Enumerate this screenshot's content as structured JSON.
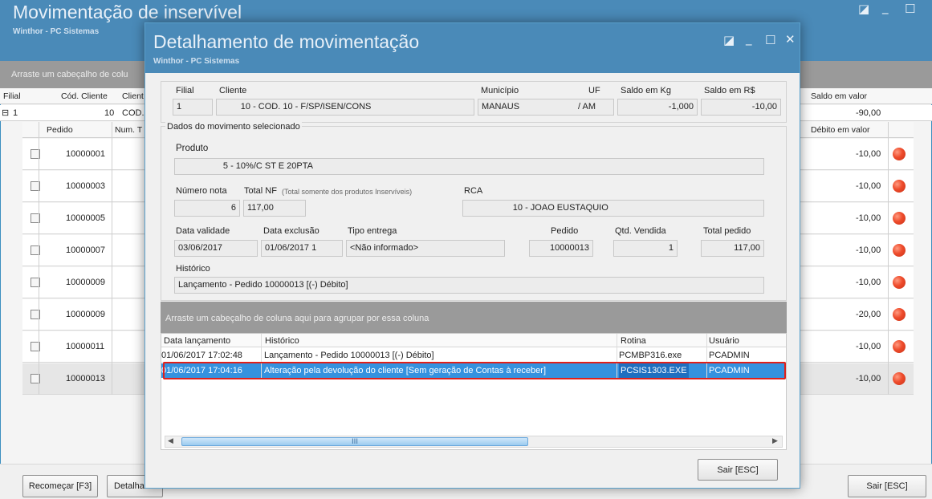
{
  "background_window": {
    "title": "Movimentação de inservível",
    "subtitle": "Winthor - PC Sistemas",
    "controls": {
      "restore": "◪",
      "minimize": "_",
      "maximize": "☐"
    },
    "group_hint": "Arraste um cabeçalho de colu",
    "headers": {
      "filial": "Filial",
      "cod_cliente": "Cód. Cliente",
      "cliente": "Client",
      "saldo_valor": "Saldo em valor"
    },
    "summary_row": {
      "expand": "⊟",
      "filial": "1",
      "cod_cliente": "10",
      "cliente": "COD.",
      "saldo_valor": "-90,00"
    },
    "detail_headers": {
      "pedido": "Pedido",
      "num": "Num. T",
      "debito": "Débito em valor"
    },
    "rows": [
      {
        "pedido": "10000001",
        "debito": "-10,00"
      },
      {
        "pedido": "10000003",
        "debito": "-10,00"
      },
      {
        "pedido": "10000005",
        "debito": "-10,00"
      },
      {
        "pedido": "10000007",
        "debito": "-10,00"
      },
      {
        "pedido": "10000009",
        "debito": "-10,00"
      },
      {
        "pedido": "10000009",
        "debito": "-20,00"
      },
      {
        "pedido": "10000011",
        "debito": "-10,00"
      },
      {
        "pedido": "10000013",
        "debito": "-10,00"
      }
    ],
    "buttons": {
      "recomecar": "Recomeçar [F3]",
      "detalhes": "Detalha",
      "sair": "Sair [ESC]"
    }
  },
  "dialog": {
    "title": "Detalhamento de movimentação",
    "subtitle": "Winthor - PC Sistemas",
    "controls": {
      "restore": "◪",
      "minimize": "_",
      "maximize": "☐",
      "close": "✕"
    },
    "header": {
      "labels": {
        "filial": "Filial",
        "cliente": "Cliente",
        "municipio": "Município",
        "uf": "UF",
        "saldo_kg": "Saldo em Kg",
        "saldo_rs": "Saldo em R$"
      },
      "values": {
        "filial": "1",
        "cliente_cod": "10",
        "cliente_nome": "COD. 10 - F/SP/ISEN/CONS",
        "municipio": "MANAUS",
        "uf": "AM",
        "saldo_kg": "-1,000",
        "saldo_rs": "-10,00"
      }
    },
    "movement": {
      "section_title": "Dados do movimento selecionado",
      "labels": {
        "produto": "Produto",
        "numero_nota": "Número nota",
        "total_nf": "Total NF",
        "total_nf_note": "(Total somente dos produtos Inservíveis)",
        "rca": "RCA",
        "data_validade": "Data validade",
        "data_exclusao": "Data exclusão",
        "tipo_entrega": "Tipo entrega",
        "pedido": "Pedido",
        "qtd_vendida": "Qtd. Vendida",
        "total_pedido": "Total pedido",
        "historico": "Histórico"
      },
      "values": {
        "produto_cod": "5",
        "produto_nome": "10%/C ST E 20PTA",
        "numero_nota": "6",
        "total_nf": "117,00",
        "rca_cod": "10",
        "rca_nome": "JOAO EUSTAQUIO",
        "data_validade": "03/06/2017",
        "data_exclusao": "01/06/2017 1",
        "tipo_entrega": "<Não informado>",
        "pedido": "10000013",
        "qtd_vendida": "1",
        "total_pedido": "117,00",
        "historico": "Lançamento - Pedido 10000013 [(-) Débito]"
      }
    },
    "history_grid": {
      "group_hint": "Arraste um cabeçalho de coluna aqui para agrupar por essa coluna",
      "headers": {
        "data": "Data lançamento",
        "historico": "Histórico",
        "rotina": "Rotina",
        "usuario": "Usuário"
      },
      "rows": [
        {
          "data": "01/06/2017 17:02:48",
          "historico": "Lançamento - Pedido 10000013 [(-) Débito]",
          "rotina": "PCMBP316.exe",
          "usuario": "PCADMIN"
        },
        {
          "data": "01/06/2017 17:04:16",
          "historico": "Alteração pela devolução do cliente [Sem geração de Contas à receber]",
          "rotina": "PCSIS1303.EXE",
          "usuario": "PCADMIN"
        }
      ],
      "scroll_thumb": "III"
    },
    "exit_button": "Sair [ESC]",
    "highlight_color": "#e0201a",
    "selection_color": "#2f8fe0"
  }
}
